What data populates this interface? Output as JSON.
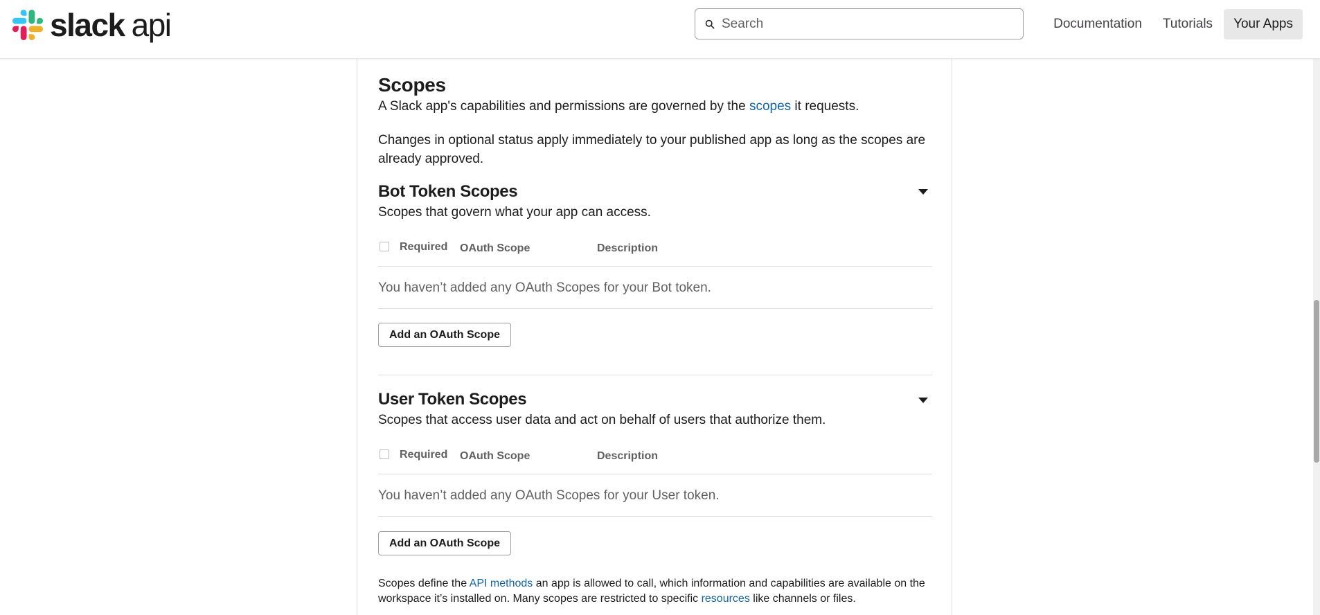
{
  "header": {
    "logo_slack": "slack",
    "logo_api": "api",
    "search_placeholder": "Search",
    "nav": [
      "Documentation",
      "Tutorials",
      "Your Apps"
    ],
    "active_nav": "Your Apps"
  },
  "scopes": {
    "title": "Scopes",
    "intro_before": "A Slack app's capabilities and permissions are governed by the ",
    "intro_link": "scopes",
    "intro_after": " it requests.",
    "optional_note": "Changes in optional status apply immediately to your published app as long as the scopes are already approved."
  },
  "bot": {
    "title": "Bot Token Scopes",
    "subtitle": "Scopes that govern what your app can access.",
    "col_required": "Required",
    "col_scope": "OAuth Scope",
    "col_description": "Description",
    "empty": "You haven’t added any OAuth Scopes for your Bot token.",
    "add_button": "Add an OAuth Scope"
  },
  "user": {
    "title": "User Token Scopes",
    "subtitle": "Scopes that access user data and act on behalf of users that authorize them.",
    "col_required": "Required",
    "col_scope": "OAuth Scope",
    "col_description": "Description",
    "empty": "You haven’t added any OAuth Scopes for your User token.",
    "add_button": "Add an OAuth Scope"
  },
  "footer_note": {
    "part1": "Scopes define the ",
    "link1": "API methods",
    "part2": " an app is allowed to call, which information and capabilities are available on the workspace it’s installed on. Many scopes are restricted to specific ",
    "link2": "resources",
    "part3": " like channels or files."
  },
  "colors": {
    "link": "#1264a3",
    "text": "#1d1c1d",
    "muted": "#616061",
    "nav_active_bg": "#e8e8e8"
  },
  "icons": {
    "logo": "slack-logo-icon",
    "search": "search-icon",
    "collapse": "caret-down-icon"
  }
}
